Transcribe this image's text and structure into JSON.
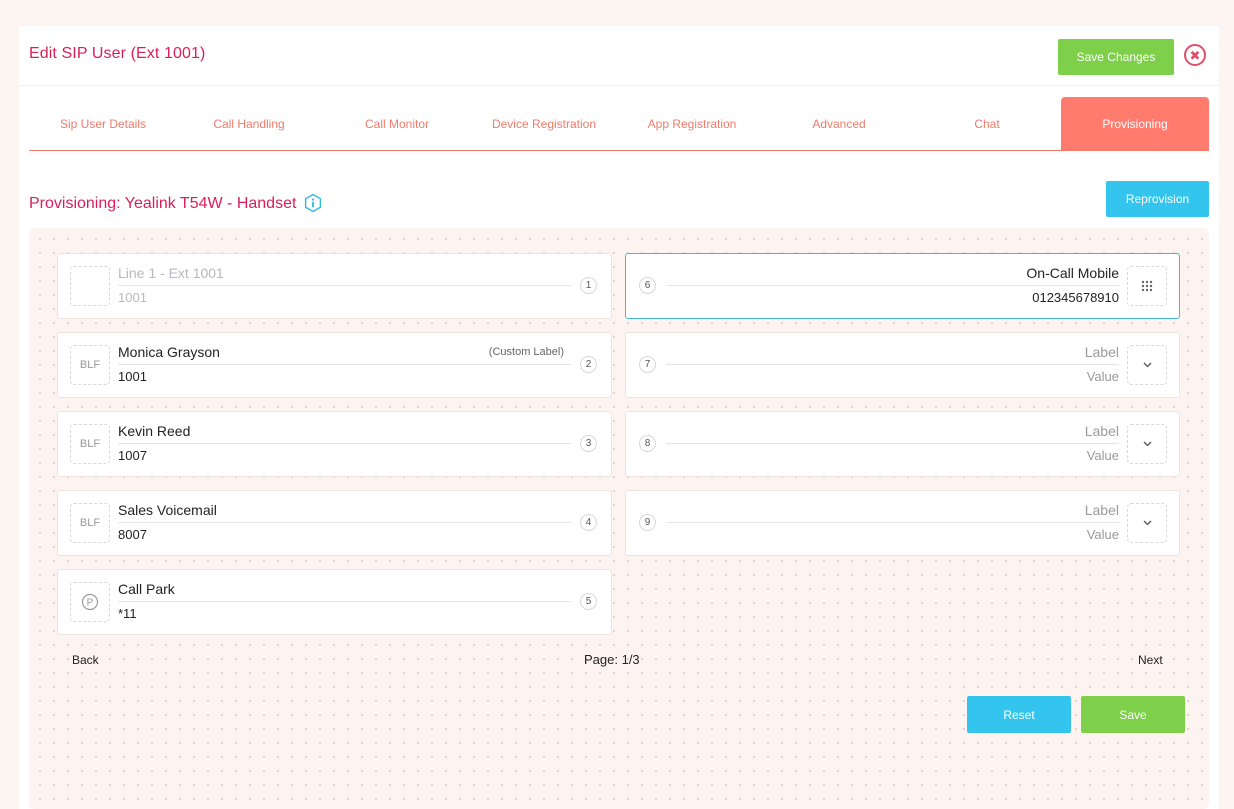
{
  "header": {
    "title": "Edit SIP User (Ext 1001)",
    "save_changes_label": "Save Changes",
    "close_icon": "close-icon"
  },
  "tabs": [
    {
      "label": "Sip User Details",
      "active": false
    },
    {
      "label": "Call Handling",
      "active": false
    },
    {
      "label": "Call Monitor",
      "active": false
    },
    {
      "label": "Device Registration",
      "active": false
    },
    {
      "label": "App Registration",
      "active": false
    },
    {
      "label": "Advanced",
      "active": false
    },
    {
      "label": "Chat",
      "active": false
    },
    {
      "label": "Provisioning",
      "active": true
    }
  ],
  "provisioning": {
    "title": "Provisioning: Yealink T54W - Handset",
    "info_icon": "info-icon",
    "reprovision_label": "Reprovision"
  },
  "left_keys": [
    {
      "number": "1",
      "type": "",
      "label": "Line 1 - Ext 1001",
      "value": "1001",
      "custom_tag": ""
    },
    {
      "number": "2",
      "type": "BLF",
      "label": "Monica Grayson",
      "value": "1001",
      "custom_tag": "(Custom Label)"
    },
    {
      "number": "3",
      "type": "BLF",
      "label": "Kevin Reed",
      "value": "1007",
      "custom_tag": ""
    },
    {
      "number": "4",
      "type": "BLF",
      "label": "Sales Voicemail",
      "value": "8007",
      "custom_tag": ""
    },
    {
      "number": "5",
      "type": "park-icon",
      "label": "Call Park",
      "value": "*11",
      "custom_tag": ""
    }
  ],
  "right_keys": [
    {
      "number": "6",
      "type": "keypad-icon",
      "label": "On-Call Mobile",
      "value": "012345678910"
    },
    {
      "number": "7",
      "type": "chevron-down-icon",
      "label": "Label",
      "value": "Value"
    },
    {
      "number": "8",
      "type": "chevron-down-icon",
      "label": "Label",
      "value": "Value"
    },
    {
      "number": "9",
      "type": "chevron-down-icon",
      "label": "Label",
      "value": "Value"
    }
  ],
  "pagination": {
    "back_label": "Back",
    "page_text": "Page: 1/3",
    "next_label": "Next"
  },
  "actions": {
    "reset_label": "Reset",
    "save_label": "Save"
  },
  "colors": {
    "accent_pink": "#d81f5a",
    "tab_coral": "#ff7b6e",
    "green": "#7ed04b",
    "blue": "#33c5ee"
  }
}
